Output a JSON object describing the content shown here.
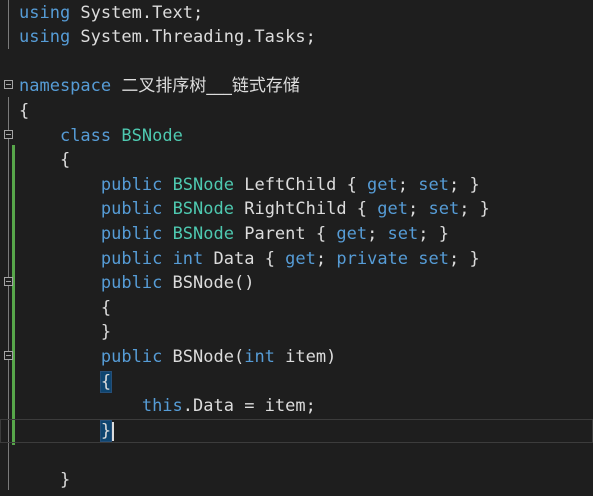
{
  "editor": {
    "lines": [
      {
        "parts": [
          {
            "t": "using",
            "c": "kw"
          },
          {
            "t": " System.Text;",
            "c": ""
          }
        ]
      },
      {
        "parts": [
          {
            "t": "using",
            "c": "kw"
          },
          {
            "t": " System.Threading.Tasks;",
            "c": ""
          }
        ]
      },
      {
        "parts": []
      },
      {
        "parts": [
          {
            "t": "namespace",
            "c": "kw"
          },
          {
            "t": " ",
            "c": ""
          },
          {
            "t": "二叉排序树___链式存储",
            "c": "cn"
          }
        ],
        "fold": true
      },
      {
        "parts": [
          {
            "t": "{",
            "c": ""
          }
        ]
      },
      {
        "parts": [
          {
            "t": "    ",
            "c": ""
          },
          {
            "t": "class",
            "c": "kw"
          },
          {
            "t": " ",
            "c": ""
          },
          {
            "t": "BSNode",
            "c": "ty"
          }
        ],
        "fold": true
      },
      {
        "parts": [
          {
            "t": "    {",
            "c": ""
          }
        ]
      },
      {
        "parts": [
          {
            "t": "        ",
            "c": ""
          },
          {
            "t": "public",
            "c": "kw"
          },
          {
            "t": " ",
            "c": ""
          },
          {
            "t": "BSNode",
            "c": "ty"
          },
          {
            "t": " LeftChild { ",
            "c": ""
          },
          {
            "t": "get",
            "c": "kw"
          },
          {
            "t": "; ",
            "c": ""
          },
          {
            "t": "set",
            "c": "kw"
          },
          {
            "t": "; }",
            "c": ""
          }
        ]
      },
      {
        "parts": [
          {
            "t": "        ",
            "c": ""
          },
          {
            "t": "public",
            "c": "kw"
          },
          {
            "t": " ",
            "c": ""
          },
          {
            "t": "BSNode",
            "c": "ty"
          },
          {
            "t": " RightChild { ",
            "c": ""
          },
          {
            "t": "get",
            "c": "kw"
          },
          {
            "t": "; ",
            "c": ""
          },
          {
            "t": "set",
            "c": "kw"
          },
          {
            "t": "; }",
            "c": ""
          }
        ]
      },
      {
        "parts": [
          {
            "t": "        ",
            "c": ""
          },
          {
            "t": "public",
            "c": "kw"
          },
          {
            "t": " ",
            "c": ""
          },
          {
            "t": "BSNode",
            "c": "ty"
          },
          {
            "t": " Parent { ",
            "c": ""
          },
          {
            "t": "get",
            "c": "kw"
          },
          {
            "t": "; ",
            "c": ""
          },
          {
            "t": "set",
            "c": "kw"
          },
          {
            "t": "; }",
            "c": ""
          }
        ]
      },
      {
        "parts": [
          {
            "t": "        ",
            "c": ""
          },
          {
            "t": "public",
            "c": "kw"
          },
          {
            "t": " ",
            "c": ""
          },
          {
            "t": "int",
            "c": "kw"
          },
          {
            "t": " Data { ",
            "c": ""
          },
          {
            "t": "get",
            "c": "kw"
          },
          {
            "t": "; ",
            "c": ""
          },
          {
            "t": "private",
            "c": "kw"
          },
          {
            "t": " ",
            "c": ""
          },
          {
            "t": "set",
            "c": "kw"
          },
          {
            "t": "; }",
            "c": ""
          }
        ]
      },
      {
        "parts": [
          {
            "t": "        ",
            "c": ""
          },
          {
            "t": "public",
            "c": "kw"
          },
          {
            "t": " BSNode()",
            "c": ""
          }
        ],
        "fold": true
      },
      {
        "parts": [
          {
            "t": "        {",
            "c": ""
          }
        ]
      },
      {
        "parts": [
          {
            "t": "        }",
            "c": ""
          }
        ]
      },
      {
        "parts": [
          {
            "t": "        ",
            "c": ""
          },
          {
            "t": "public",
            "c": "kw"
          },
          {
            "t": " BSNode(",
            "c": ""
          },
          {
            "t": "int",
            "c": "kw"
          },
          {
            "t": " item)",
            "c": ""
          }
        ],
        "fold": true
      },
      {
        "parts": [
          {
            "t": "        ",
            "c": ""
          },
          {
            "t": "{",
            "c": "brace-hl"
          }
        ]
      },
      {
        "parts": [
          {
            "t": "            ",
            "c": ""
          },
          {
            "t": "this",
            "c": "kw"
          },
          {
            "t": ".Data = item;",
            "c": ""
          }
        ]
      },
      {
        "parts": [
          {
            "t": "        ",
            "c": ""
          },
          {
            "t": "}",
            "c": "brace-hl"
          }
        ],
        "current": true
      },
      {
        "parts": []
      },
      {
        "parts": [
          {
            "t": "    }",
            "c": ""
          }
        ]
      },
      {
        "parts": [
          {
            "t": "}",
            "c": ""
          }
        ]
      }
    ]
  }
}
